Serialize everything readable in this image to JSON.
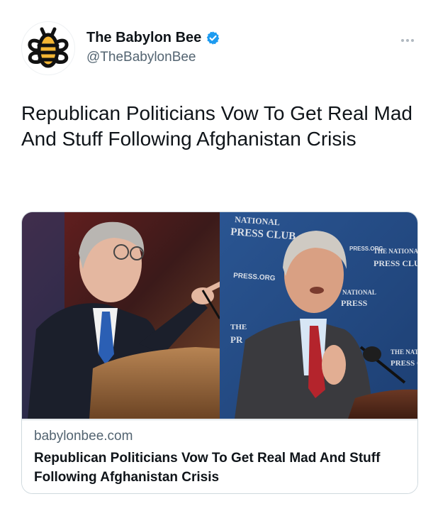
{
  "tweet": {
    "author": {
      "display_name": "The Babylon Bee",
      "handle": "@TheBabylonBee",
      "verified": true,
      "avatar_icon": "bee-logo-icon"
    },
    "more_icon": "more-dots-icon",
    "text": "Republican Politicians Vow To Get Real Mad And Stuff Following Afghanistan Crisis",
    "card": {
      "domain": "babylonbee.com",
      "title": "Republican Politicians Vow To Get Real Mad And Stuff Following Afghanistan Crisis",
      "image": {
        "left_backdrop_text": "",
        "right_backdrop_texts": [
          "NATIONAL",
          "PRESS CLUB",
          "PRESS.ORG",
          "THE NATIONAL",
          "PRESS CLUB",
          "THE",
          "PR",
          "NATIONAL",
          "PRESS",
          "PRESS.ORG",
          "THE NATIO",
          "PRESS CL"
        ]
      }
    }
  },
  "colors": {
    "text_primary": "#0f1419",
    "text_secondary": "#536471",
    "verified_blue": "#1d9bf0",
    "card_border": "#cfd9de",
    "press_club_blue": "#2f5a96"
  }
}
